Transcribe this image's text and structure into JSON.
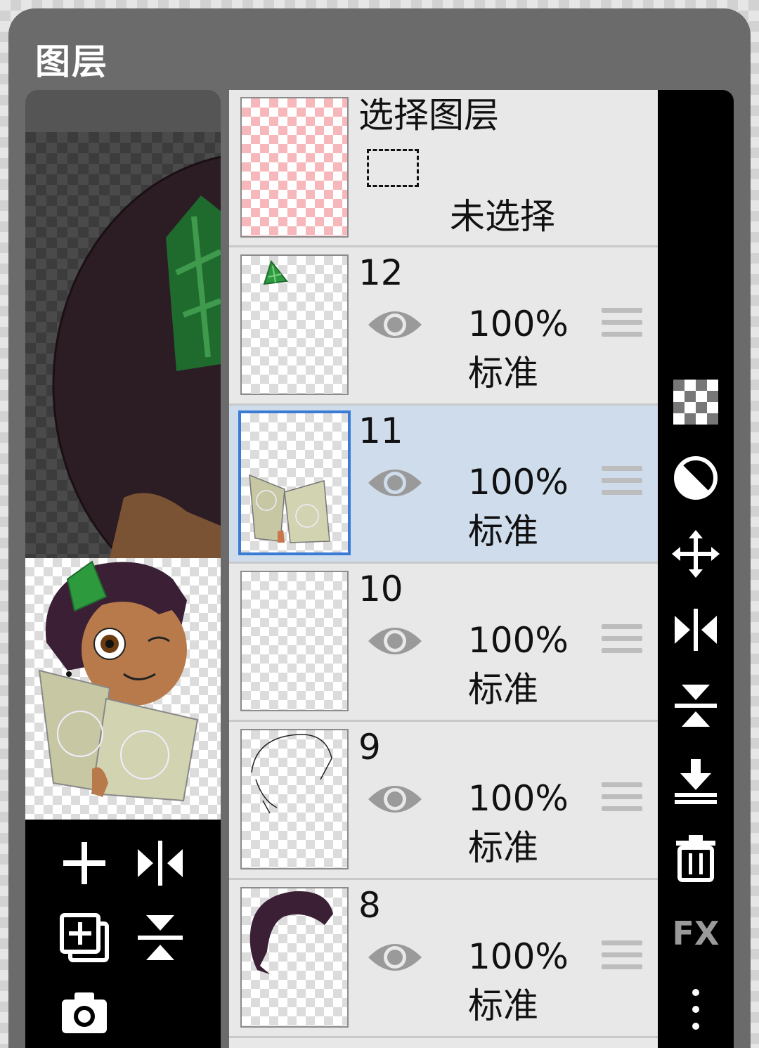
{
  "dialog": {
    "title": "图层"
  },
  "selection_layer": {
    "title": "选择图层",
    "status": "未选择"
  },
  "layers": [
    {
      "name": "12",
      "opacity": "100%",
      "blend": "标准",
      "visible": true,
      "selected": false
    },
    {
      "name": "11",
      "opacity": "100%",
      "blend": "标准",
      "visible": true,
      "selected": true
    },
    {
      "name": "10",
      "opacity": "100%",
      "blend": "标准",
      "visible": true,
      "selected": false
    },
    {
      "name": "9",
      "opacity": "100%",
      "blend": "标准",
      "visible": true,
      "selected": false
    },
    {
      "name": "8",
      "opacity": "100%",
      "blend": "标准",
      "visible": true,
      "selected": false
    }
  ],
  "right_toolbar": {
    "icons": [
      "transparency-checker-icon",
      "blend-mode-icon",
      "move-icon",
      "flip-horizontal-icon",
      "flip-vertical-icon",
      "merge-down-icon",
      "trash-icon",
      "fx-icon",
      "more-vert-icon"
    ],
    "fx_label": "FX"
  },
  "left_toolbar": {
    "icons": [
      "add-layer-icon",
      "flip-horizontal-icon",
      "duplicate-layer-icon",
      "flip-vertical-icon",
      "camera-icon"
    ]
  },
  "colors": {
    "dialog_bg": "#6b6b6b",
    "list_bg": "#e8e8e8",
    "selected_row": "#cfdcec",
    "selected_border": "#3a7bd5",
    "toolbar_bg": "#000000"
  }
}
